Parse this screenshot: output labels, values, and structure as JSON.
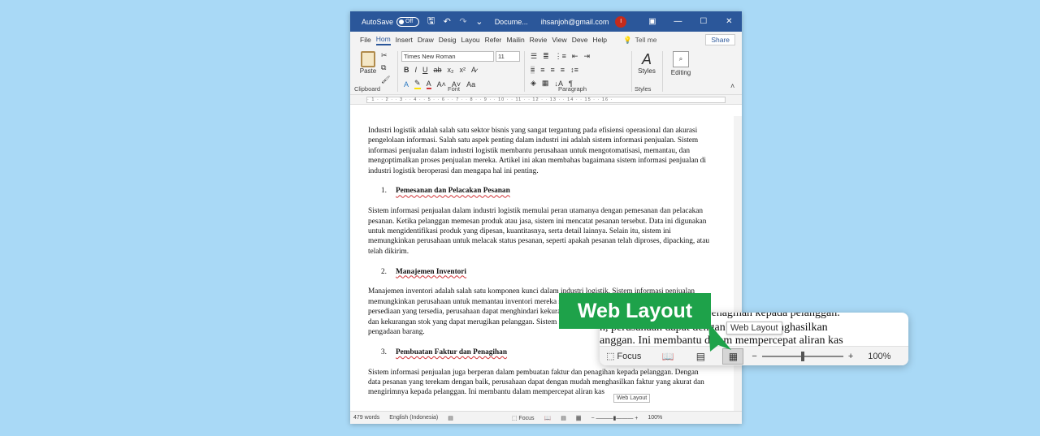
{
  "titlebar": {
    "autosave_label": "AutoSave",
    "autosave_state": "Off",
    "doc_title": "Docume...",
    "email": "ihsanjoh@gmail.com",
    "user_initial": "I"
  },
  "menu": {
    "tabs": [
      "File",
      "Hom",
      "Insert",
      "Draw",
      "Desig",
      "Layou",
      "Refer",
      "Mailin",
      "Revie",
      "View",
      "Deve",
      "Help"
    ],
    "tell_me": "Tell me",
    "share": "Share"
  },
  "ribbon": {
    "paste_label": "Paste",
    "font_name": "Times New Roman",
    "font_size": "11",
    "styles_label": "Styles",
    "editing_label": "Editing",
    "groups": {
      "clipboard": "Clipboard",
      "font": "Font",
      "paragraph": "Paragraph",
      "styles": "Styles"
    }
  },
  "ruler_text": "· 1 · ·  2 · · 3 · · 4 · · 5 · · 6 · · 7 · · 8 · · 9 · · 10 · · 11 · · 12 · · 13 · · 14 · · 15 · · 16 ·",
  "document": {
    "p1": "Industri logistik adalah salah satu sektor bisnis yang sangat tergantung pada efisiensi operasional dan akurasi pengelolaan informasi. Salah satu aspek penting dalam industri ini adalah sistem informasi penjualan. Sistem informasi penjualan dalam industri logistik membantu perusahaan untuk mengotomatisasi, memantau, dan mengoptimalkan proses penjualan mereka. Artikel ini akan membahas bagaimana sistem informasi penjualan di industri logistik beroperasi dan mengapa hal ini penting.",
    "h1_num": "1.",
    "h1": "Pemesanan dan Pelacakan Pesanan",
    "p2": "Sistem informasi penjualan dalam industri logistik memulai peran utamanya dengan pemesanan dan pelacakan pesanan. Ketika pelanggan memesan produk atau jasa, sistem ini mencatat pesanan tersebut. Data ini digunakan untuk mengidentifikasi produk yang dipesan, kuantitasnya, serta detail lainnya. Selain itu, sistem ini memungkinkan perusahaan untuk melacak status pesanan, seperti apakah pesanan telah diproses, dipacking, atau telah dikirim.",
    "h2_num": "2.",
    "h2": "Manajemen Inventori",
    "p3": "Manajemen inventori adalah salah satu komponen kunci dalam industri logistik. Sistem informasi penjualan memungkinkan perusahaan untuk memantau inventori mereka secara real-time. Dengan memantau tingkat persediaan yang tersedia, perusahaan dapat menghindari kekurangan stok dan kelebihan stok, karena kelebihan dan kekurangan stok yang dapat merugikan pelanggan. Sistem ini juga membantu dalam perencanaan dan pengadaan barang.",
    "h3_num": "3.",
    "h3": "Pembuatan Faktur dan Penagihan",
    "p4": "Sistem informasi penjualan juga berperan dalam pembuatan faktur dan penagihan kepada pelanggan. Dengan data pesanan yang terekam dengan baik, perusahaan dapat dengan mudah menghasilkan faktur yang akurat dan mengirimnya kepada pelanggan. Ini membantu dalam mempercepat aliran kas"
  },
  "statusbar": {
    "words": "479 words",
    "language": "English (Indonesia)",
    "focus": "Focus",
    "zoom": "100%",
    "tooltip": "Web Layout"
  },
  "zoom_panel": {
    "line1": "n penagihan kepada pelanggan.",
    "line2_left": "n, perusahaan dapat dengan",
    "line2_right": "nghasilkan",
    "line3": "anggan. Ini membantu dalam mempercepat aliran kas",
    "focus": "Focus",
    "tooltip": "Web Layout",
    "zoom": "100%"
  },
  "callout_label": "Web Layout",
  "colors": {
    "word_blue": "#2b579a",
    "callout_green": "#1ea24a",
    "background": "#a9d9f6"
  }
}
